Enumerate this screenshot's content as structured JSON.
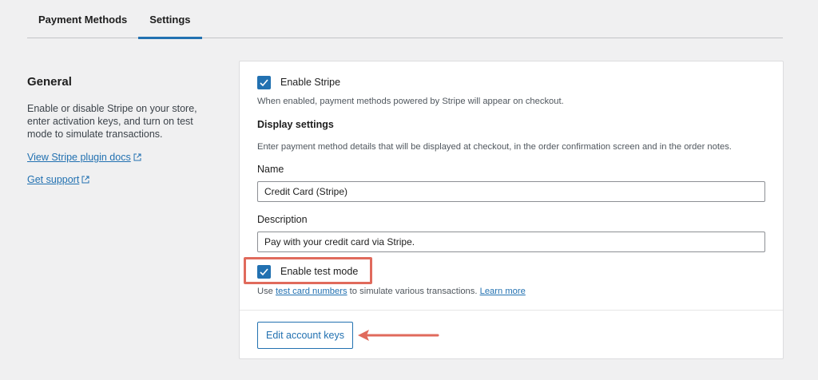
{
  "tabs": [
    {
      "label": "Payment Methods",
      "active": false
    },
    {
      "label": "Settings",
      "active": true
    }
  ],
  "general": {
    "title": "General",
    "description": "Enable or disable Stripe on your store, enter activation keys, and turn on test mode to simulate transactions.",
    "docs_link": "View Stripe plugin docs",
    "support_link": "Get support"
  },
  "settings": {
    "enable_stripe": {
      "label": "Enable Stripe",
      "checked": true
    },
    "enable_stripe_help": "When enabled, payment methods powered by Stripe will appear on checkout.",
    "display_title": "Display settings",
    "display_help": "Enter payment method details that will be displayed at checkout, in the order confirmation screen and in the order notes.",
    "name_label": "Name",
    "name_value": "Credit Card (Stripe)",
    "description_label": "Description",
    "description_value": "Pay with your credit card via Stripe.",
    "test_mode": {
      "label": "Enable test mode",
      "checked": true
    },
    "test_help_prefix": "Use ",
    "test_help_link": "test card numbers",
    "test_help_suffix": " to simulate various transactions. ",
    "learn_more": "Learn more",
    "edit_keys_button": "Edit account keys"
  },
  "colors": {
    "accent": "#2271b1",
    "annotation": "#e06a5c",
    "background": "#f0f0f1"
  },
  "icons": {
    "checkbox": "checkmark-icon",
    "external": "external-link-icon",
    "annotation": "arrow-left-icon"
  }
}
